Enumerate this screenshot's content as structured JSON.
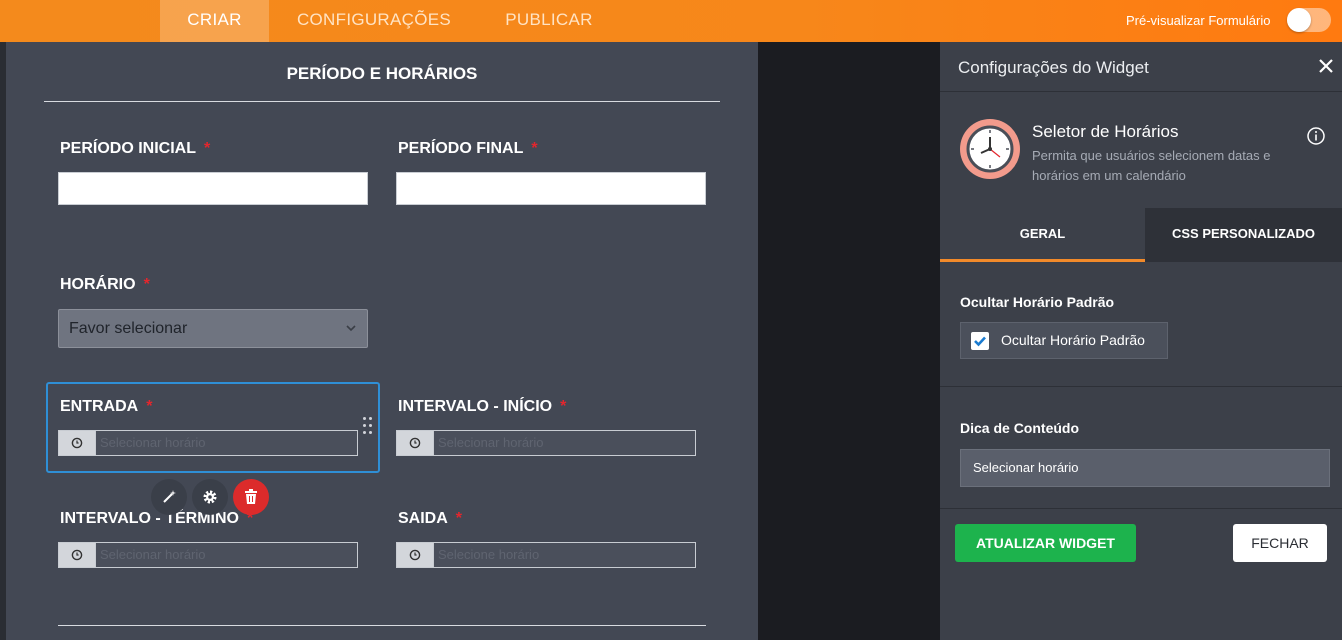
{
  "topbar": {
    "tabs": [
      {
        "label": "CRIAR",
        "active": true
      },
      {
        "label": "CONFIGURAÇÕES",
        "active": false
      },
      {
        "label": "PUBLICAR",
        "active": false
      }
    ],
    "preview_label": "Pré-visualizar Formulário",
    "preview_toggle_on": false
  },
  "form": {
    "section_title": "PERÍODO E HORÁRIOS",
    "required_mark": "*",
    "periodo_inicial": {
      "label": "PERÍODO INICIAL",
      "value": ""
    },
    "periodo_final": {
      "label": "PERÍODO FINAL",
      "value": ""
    },
    "horario": {
      "label": "HORÁRIO",
      "selected": "Favor selecionar"
    },
    "entrada": {
      "label": "ENTRADA",
      "placeholder": "Selecionar horário"
    },
    "intervalo_inicio": {
      "label": "INTERVALO - INÍCIO",
      "placeholder": "Selecionar horário"
    },
    "intervalo_termino": {
      "label": "INTERVALO - TÉRMINO",
      "placeholder": "Selecionar horário"
    },
    "saida": {
      "label": "SAIDA",
      "placeholder": "Selecione horário"
    }
  },
  "panel": {
    "title": "Configurações do Widget",
    "widget_name": "Seletor de Horários",
    "widget_desc": "Permita que usuários selecionem datas e horários em um calendário",
    "tabs": [
      {
        "label": "GERAL",
        "active": true
      },
      {
        "label": "CSS PERSONALIZADO",
        "active": false
      }
    ],
    "hide_default": {
      "title": "Ocultar Horário Padrão",
      "checkbox_label": "Ocultar Horário Padrão",
      "checked": true
    },
    "hint": {
      "title": "Dica de Conteúdo",
      "value": "Selecionar horário"
    },
    "update_button": "ATUALIZAR WIDGET",
    "close_button": "FECHAR"
  },
  "colors": {
    "accent": "#f48a1c",
    "selection": "#2f8fd6",
    "delete": "#dc2b2b",
    "update": "#1db34d",
    "required": "#e3262d"
  }
}
